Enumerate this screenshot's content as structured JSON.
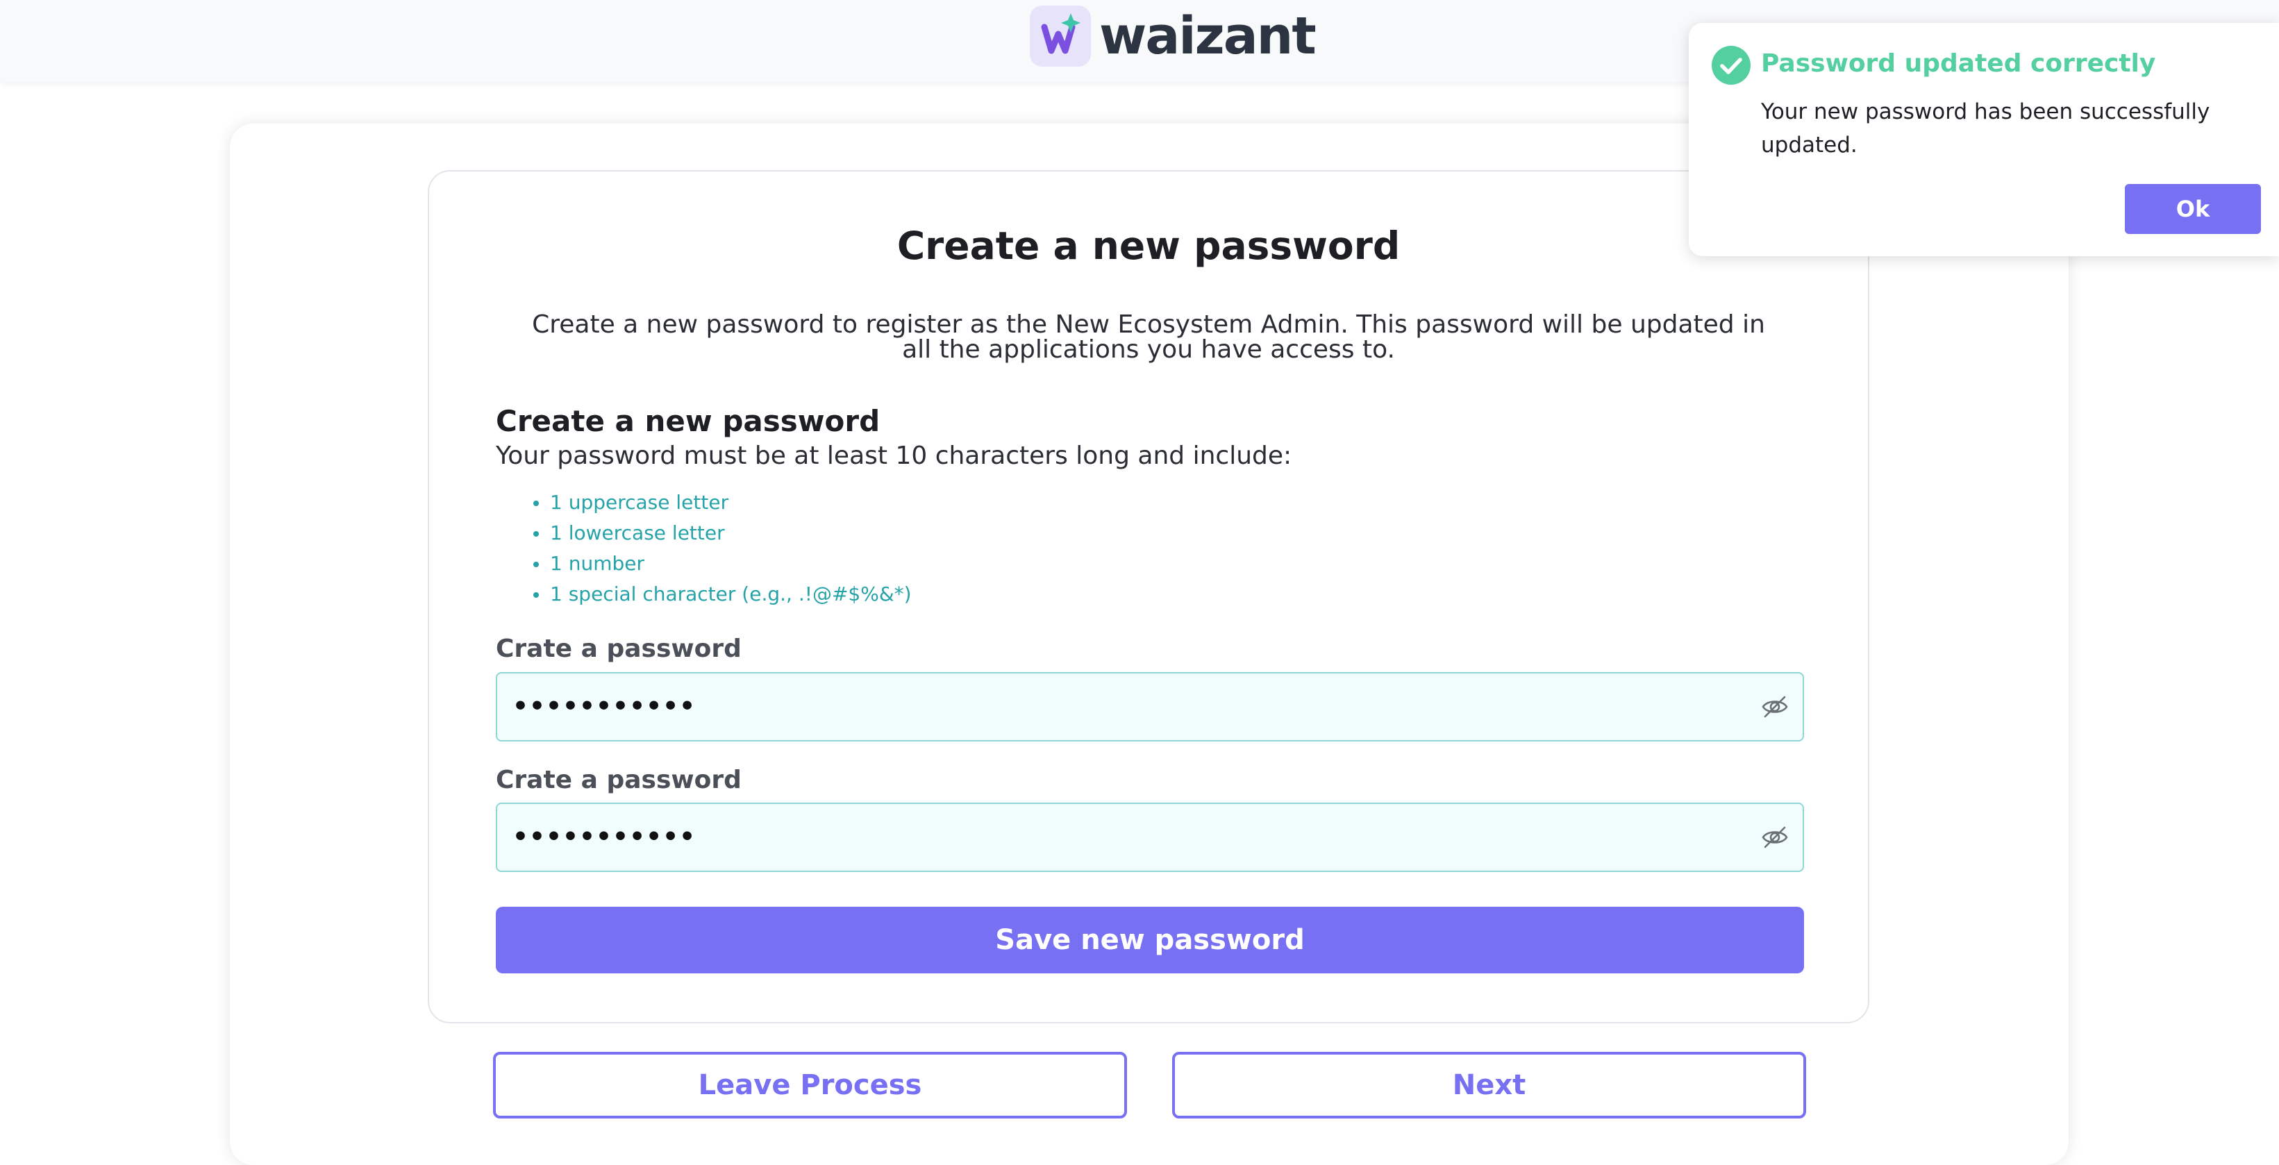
{
  "header": {
    "brand_name": "waizant",
    "logo_letter": "w"
  },
  "form": {
    "title": "Create a new password",
    "subtitle": "Create a new password to register as the New Ecosystem Admin. This password will be updated in all the applications you have access to.",
    "section_heading": "Create a new password",
    "section_description": "Your password must be at least 10 characters long and include:",
    "requirements": [
      "1 uppercase letter",
      "1 lowercase letter",
      "1 number",
      "1 special character (e.g., .!@#$%&*)"
    ],
    "password_label": "Crate a password",
    "password_value": "•••••••••••",
    "confirm_label": "Crate a password",
    "confirm_value": "•••••••••••",
    "save_label": "Save new password"
  },
  "footer": {
    "leave_label": "Leave Process",
    "next_label": "Next"
  },
  "toast": {
    "title": "Password updated correctly",
    "message": "Your new password has been successfully updated.",
    "ok_label": "Ok"
  },
  "colors": {
    "primary": "#7870f2",
    "teal": "#26a3a8",
    "success": "#53cfa0",
    "input_bg": "#f1fdfd",
    "input_border": "#8fd6d8"
  },
  "icons": {
    "logo": "sparkle-w-logo-icon",
    "eye_toggle": "eye-slash-icon",
    "toast_status": "check-circle-icon"
  }
}
